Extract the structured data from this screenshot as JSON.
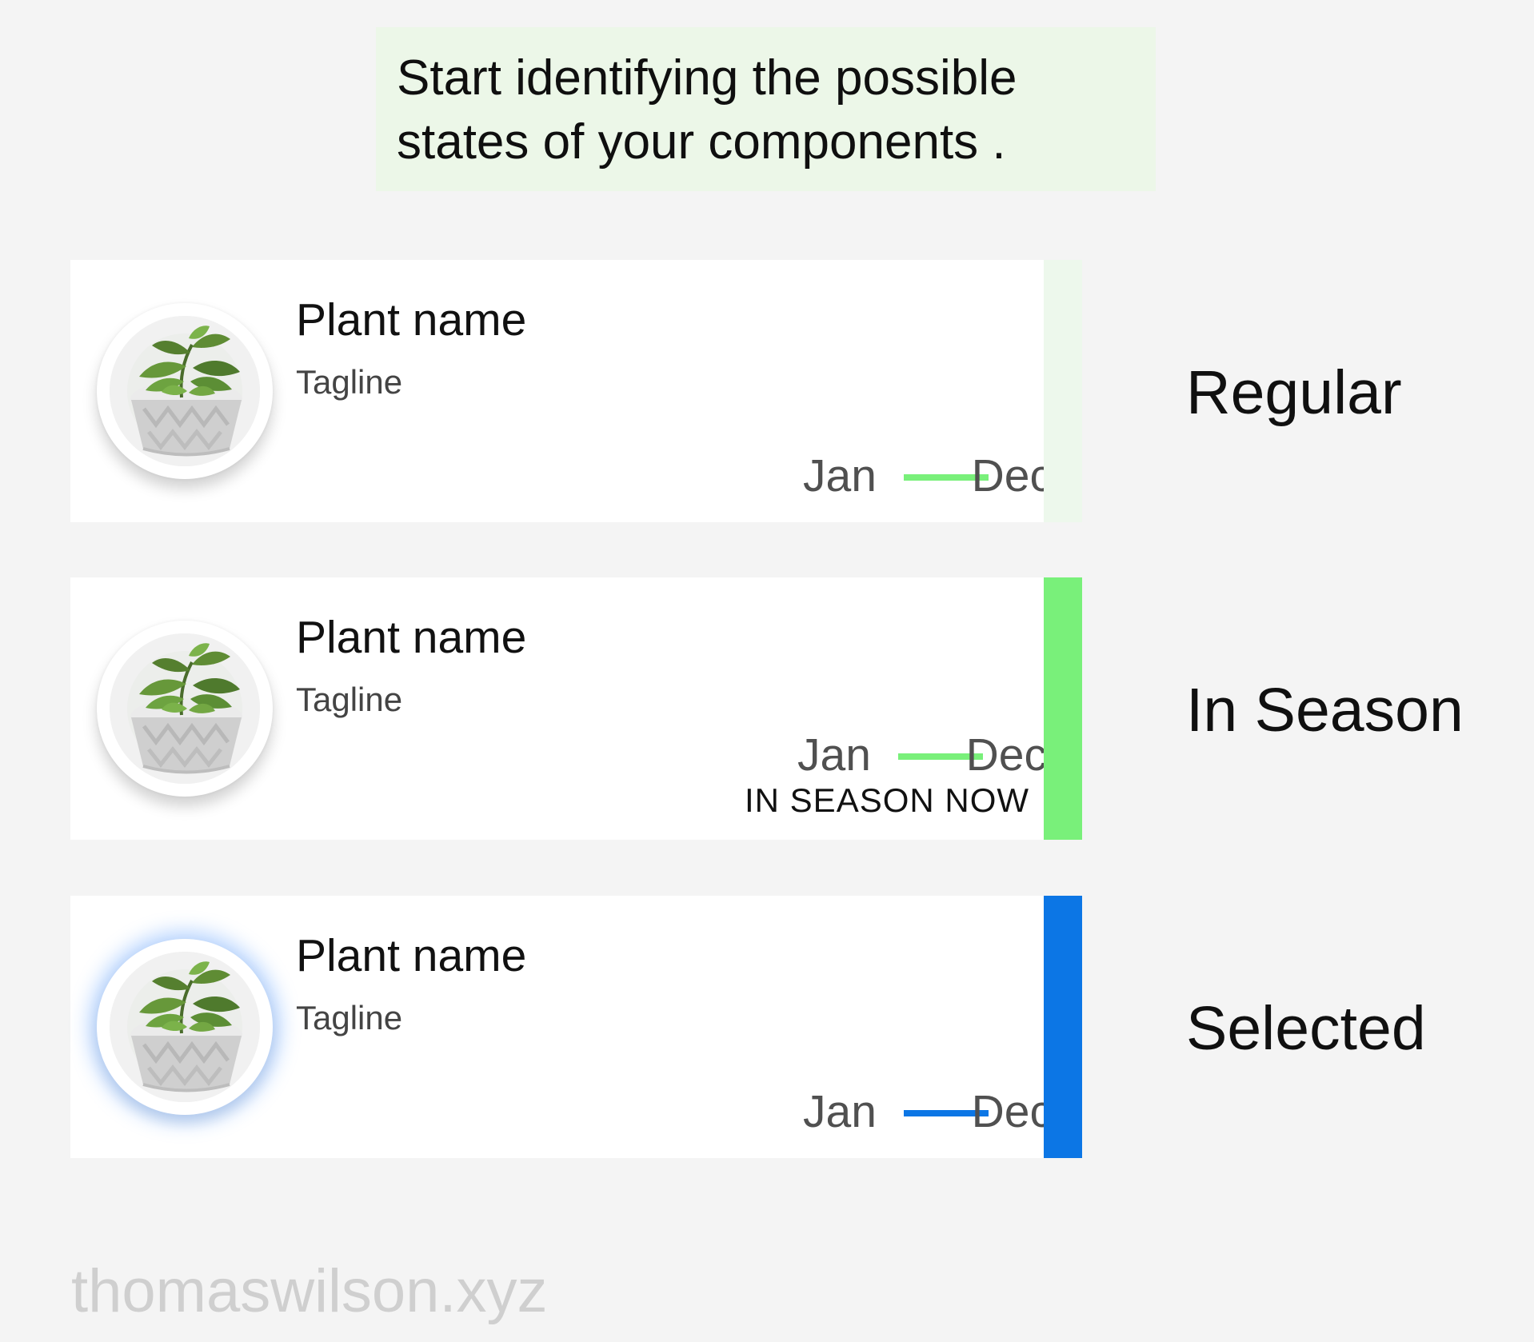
{
  "callout": {
    "line1": "Start identifying the possible",
    "line2": "states of your components ."
  },
  "cards": [
    {
      "state": "regular",
      "plant_name": "Plant name",
      "tagline": "Tagline",
      "range_start": "Jan",
      "range_end": "Dec",
      "line_color": "#79f07a",
      "strip_color": "#edf8ec",
      "avatar_icon": "potted-basil-photo",
      "label": "Regular"
    },
    {
      "state": "in-season",
      "plant_name": "Plant name",
      "tagline": "Tagline",
      "range_start": "Jan",
      "range_end": "Dec",
      "line_color": "#79f07a",
      "strip_color": "#79f07a",
      "avatar_icon": "potted-basil-photo",
      "badge": "IN SEASON NOW",
      "label": "In Season"
    },
    {
      "state": "selected",
      "plant_name": "Plant name",
      "tagline": "Tagline",
      "range_start": "Jan",
      "range_end": "Dec",
      "line_color": "#0c76e5",
      "strip_color": "#0c76e5",
      "avatar_icon": "potted-basil-photo",
      "label": "Selected"
    }
  ],
  "watermark": "thomaswilson.xyz"
}
